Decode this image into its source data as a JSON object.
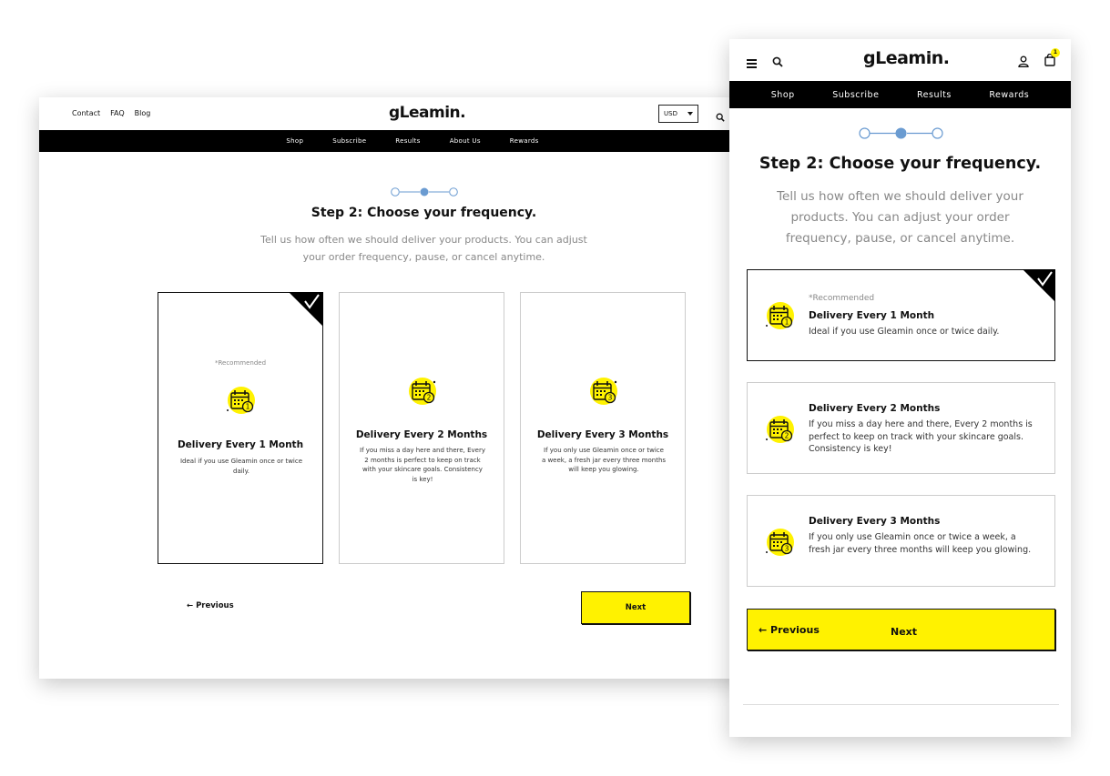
{
  "brand": {
    "logo": "gLeamin.",
    "accent": "#fff200"
  },
  "desktop": {
    "top_links": [
      "Contact",
      "FAQ",
      "Blog"
    ],
    "currency": "USD",
    "nav": [
      "Shop",
      "Subscribe",
      "Results",
      "About Us",
      "Rewards"
    ],
    "progress": {
      "current_step": 2,
      "total_steps": 3
    },
    "title": "Step 2: Choose your frequency.",
    "subtitle": "Tell us how often we should deliver your products. You can adjust your order frequency, pause, or cancel anytime.",
    "cards": [
      {
        "recommended": "*Recommended",
        "title": "Delivery Every 1 Month",
        "desc": "Ideal if you use Gleamin once or twice daily.",
        "icon_num": "1",
        "selected": true
      },
      {
        "recommended": "",
        "title": "Delivery Every 2 Months",
        "desc": "If you miss a day here and there, Every 2 months is perfect to keep on track with your skincare goals. Consistency is key!",
        "icon_num": "2",
        "selected": false
      },
      {
        "recommended": "",
        "title": "Delivery Every 3 Months",
        "desc": "If you only use Gleamin once or twice a week, a fresh jar every three months will keep you glowing.",
        "icon_num": "3",
        "selected": false
      }
    ],
    "previous_label": "← Previous",
    "next_label": "Next"
  },
  "mobile": {
    "nav": [
      "Shop",
      "Subscribe",
      "Results",
      "Rewards"
    ],
    "cart_count": "1",
    "progress": {
      "current_step": 2,
      "total_steps": 3
    },
    "title": "Step 2: Choose your frequency.",
    "subtitle": "Tell us how often we should deliver your products. You can adjust your order frequency, pause, or cancel anytime.",
    "cards": [
      {
        "recommended": "*Recommended",
        "title": "Delivery Every 1 Month",
        "desc": "Ideal if you use Gleamin once or twice daily.",
        "icon_num": "1",
        "selected": true
      },
      {
        "recommended": "",
        "title": "Delivery Every 2 Months",
        "desc": "If you miss a day here and there, Every 2 months is perfect to keep on track with your skincare goals. Consistency is key!",
        "icon_num": "2",
        "selected": false
      },
      {
        "recommended": "",
        "title": "Delivery Every 3 Months",
        "desc": "If you only use Gleamin once or twice a week, a fresh jar every three months will keep you glowing.",
        "icon_num": "3",
        "selected": false
      }
    ],
    "previous_label": "← Previous",
    "next_label": "Next"
  }
}
